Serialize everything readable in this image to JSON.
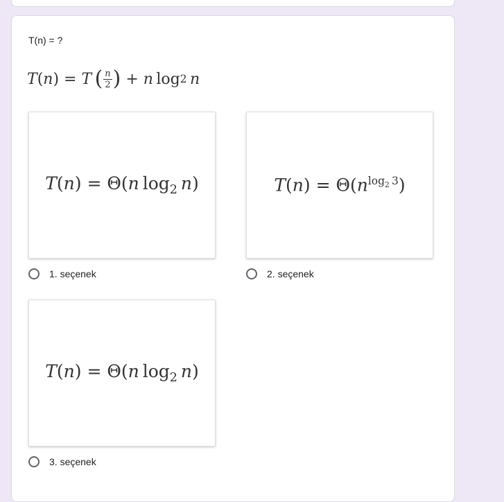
{
  "question": {
    "title": "T(n) = ?"
  },
  "options": [
    {
      "formula_id": "theta-n-log2-n",
      "label": "1. seçenek"
    },
    {
      "formula_id": "theta-n-pow-log2-3",
      "label": "2. seçenek"
    },
    {
      "formula_id": "theta-n-log2-n",
      "label": "3. seçenek"
    }
  ],
  "colors": {
    "page_background": "#ede7f6",
    "card_background": "#ffffff",
    "text": "#202124",
    "radio_border": "#5f6368"
  }
}
